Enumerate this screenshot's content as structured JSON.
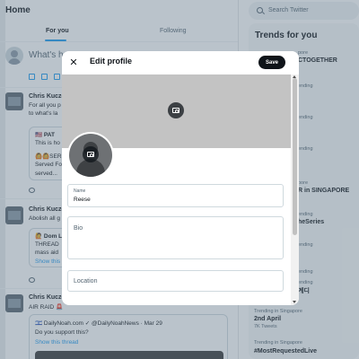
{
  "timeline": {
    "title": "Home",
    "tabs": [
      {
        "label": "For you",
        "active": true
      },
      {
        "label": "Following",
        "active": false
      }
    ],
    "compose_prompt": "What's h",
    "posts": [
      {
        "author": "Chris Kuczo",
        "lines": [
          "For all you p",
          "to what's la"
        ]
      },
      {
        "quote_lines": [
          "🇺🇸 PAT",
          "This is ho",
          "🙆🙆SER",
          "Served Fo",
          "served..."
        ]
      },
      {
        "author": "Chris Kuczo",
        "lines": [
          "Abolish all g"
        ]
      },
      {
        "quote_lines": [
          "🙋 Dom L",
          "THREAD",
          "mass aid",
          "Show this"
        ]
      },
      {
        "author": "Chris Kuczo",
        "lines": [
          "AIR RAID 🚨"
        ]
      },
      {
        "quote_author": "🇮🇱 DailyNoah.com ✓ @DailyNoahNews · Mar 29",
        "quote_lines": [
          "Do you support this?"
        ],
        "quote_link": "Show this thread"
      }
    ]
  },
  "sidebar": {
    "search_placeholder": "Search Twitter",
    "trends_title": "Trends for you",
    "trends": [
      {
        "context": "pore",
        "name": "CTOGETHER",
        "count": ""
      },
      {
        "context": "ending",
        "name": "",
        "count": ""
      },
      {
        "context": "ending",
        "name": "",
        "count": ""
      },
      {
        "context": "ending",
        "name": "",
        "count": ""
      },
      {
        "context": "pore",
        "name": "R in SINGAPORE",
        "count": ""
      },
      {
        "context": "ending",
        "name": "heSeries",
        "count": ""
      },
      {
        "context": "ending",
        "name": "",
        "count": ""
      },
      {
        "context": "ending",
        "name": "",
        "count": ""
      },
      {
        "context": "ending",
        "name": "계디",
        "count": ""
      },
      {
        "context": "Trending in Singapore",
        "name": "2nd April",
        "count": "7K Tweets"
      },
      {
        "context": "Trending in Singapore",
        "name": "#MostRequestedLive",
        "count": ""
      }
    ]
  },
  "modal": {
    "title": "Edit profile",
    "close_symbol": "✕",
    "save_label": "Save",
    "fields": {
      "name": {
        "label": "Name",
        "value": "Reese"
      },
      "bio": {
        "placeholder": "Bio"
      },
      "location": {
        "placeholder": "Location"
      }
    }
  },
  "icons": {
    "close": "close-icon",
    "banner_camera": "add-photo-icon",
    "avatar_camera": "add-photo-icon",
    "search": "search-icon"
  },
  "colors": {
    "accent": "#1d9bf0",
    "save_button": "#0f1419",
    "banner": "#c3c3c3",
    "overlay": "#5b7083"
  }
}
